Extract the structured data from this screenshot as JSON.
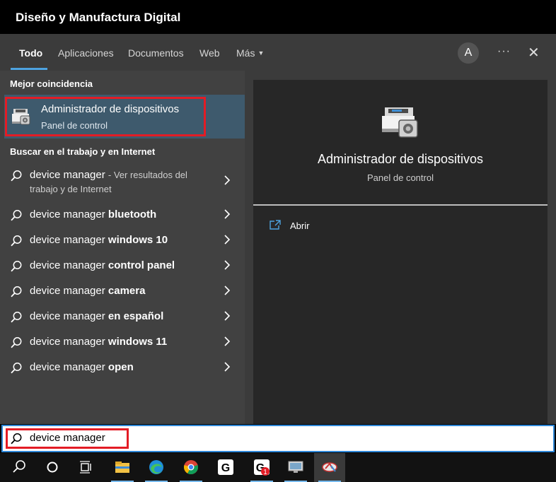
{
  "window": {
    "title": "Diseño y Manufactura Digital"
  },
  "tabs": [
    {
      "label": "Todo",
      "active": true
    },
    {
      "label": "Aplicaciones"
    },
    {
      "label": "Documentos"
    },
    {
      "label": "Web"
    },
    {
      "label": "Más"
    }
  ],
  "header": {
    "avatar_letter": "A",
    "more_label": "···",
    "close_label": "✕"
  },
  "best_match": {
    "heading": "Mejor coincidencia",
    "title": "Administrador de dispositivos",
    "subtitle": "Panel de control",
    "icon": "device-manager-icon"
  },
  "web_search": {
    "heading": "Buscar en el trabajo y en Internet",
    "first": {
      "query": "device manager",
      "suffix": "- Ver resultados del",
      "line2": "trabajo y de Internet"
    },
    "items": [
      {
        "base": "device manager",
        "bold": "bluetooth"
      },
      {
        "base": "device manager",
        "bold": "windows 10"
      },
      {
        "base": "device manager",
        "bold": "control panel"
      },
      {
        "base": "device manager",
        "bold": "camera"
      },
      {
        "base": "device manager",
        "bold": "en español"
      },
      {
        "base": "device manager",
        "bold": "windows 11"
      },
      {
        "base": "device manager",
        "bold": "open"
      }
    ]
  },
  "preview": {
    "title": "Administrador de dispositivos",
    "subtitle": "Panel de control",
    "actions": [
      {
        "label": "Abrir",
        "icon": "open-icon"
      }
    ]
  },
  "search": {
    "value": "device manager"
  },
  "taskbar": {
    "icons": [
      "search-icon",
      "cortana-icon",
      "task-view-icon",
      "file-explorer-icon",
      "edge-icon",
      "chrome-icon",
      "g-app-icon",
      "g-app-notification-icon",
      "monitor-app-icon",
      "settings-app-icon"
    ],
    "badge": "1"
  },
  "colors": {
    "accent": "#4da3e0",
    "highlight": "#3e5a6d",
    "outline": "#e31c25"
  }
}
